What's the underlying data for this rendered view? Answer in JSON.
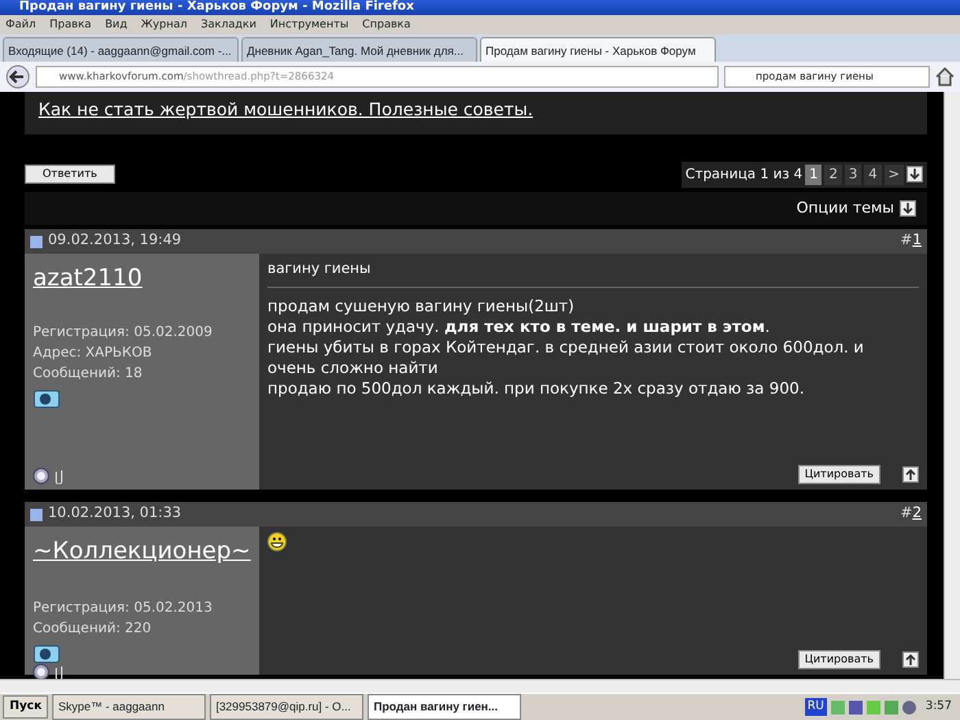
{
  "window": {
    "title": "Продан вагину гиены - Харьков Форум - Mozilla Firefox"
  },
  "menu": [
    "Файл",
    "Правка",
    "Вид",
    "Журнал",
    "Закладки",
    "Инструменты",
    "Справка"
  ],
  "tabs": [
    {
      "label": "Входящие (14) - aaggaann@gmail.com -...",
      "selected": false
    },
    {
      "label": "Дневник Agan_Tang. Мой дневник для...",
      "selected": false
    },
    {
      "label": "Продам вагину гиены - Харьков Форум",
      "selected": true
    }
  ],
  "address": {
    "host": "www.kharkovforum.com",
    "path": "/showthread.php?t=2866324"
  },
  "search": {
    "value": "продам вагину гиены"
  },
  "page": {
    "top_link": "Как не стать жертвой мошенников. Полезные советы.",
    "reply_button": "Ответить",
    "pagination": {
      "label": "Страница 1 из 4",
      "pages": [
        {
          "label": "1",
          "selected": true
        },
        {
          "label": "2",
          "selected": false
        },
        {
          "label": "3",
          "selected": false
        },
        {
          "label": "4",
          "selected": false
        },
        {
          "label": ">",
          "selected": false
        }
      ]
    },
    "thread_options": "Опции темы",
    "posts": [
      {
        "date": "09.02.2013, 19:49",
        "hash": "#",
        "number": "1",
        "username": "azat2110",
        "details": [
          "Регистрация: 05.02.2009",
          "Адрес: ХАРЬКОВ",
          "Сообщений: 18"
        ],
        "title": "вагину гиены",
        "lines": [
          "продам сушеную вагину гиены(2шт)",
          "она приносит удачу. **для тех кто в теме. и шарит в этом**.",
          "гиены убиты в горах Койтендаг. в средней азии стоит около 600дол. и",
          "очень сложно найти",
          "продаю по 500дол каждый. при покупке 2х сразу отдаю за 900."
        ],
        "smiley": false,
        "quote_button": "Цитировать"
      },
      {
        "date": "10.02.2013, 01:33",
        "hash": "#",
        "number": "2",
        "username": "~Коллекционер~",
        "details": [
          "Регистрация: 05.02.2013",
          "Сообщений: 220"
        ],
        "smiley": true,
        "quote_button": "Цитировать"
      }
    ]
  },
  "taskbar": {
    "start": "Пуск",
    "items": [
      {
        "label": "Skype™ - aaggaann",
        "selected": false
      },
      {
        "label": "[329953879@qip.ru] - О...",
        "selected": false
      },
      {
        "label": "Продан вагину гиен...",
        "selected": true
      }
    ],
    "language": "RU",
    "clock": "3:57"
  }
}
